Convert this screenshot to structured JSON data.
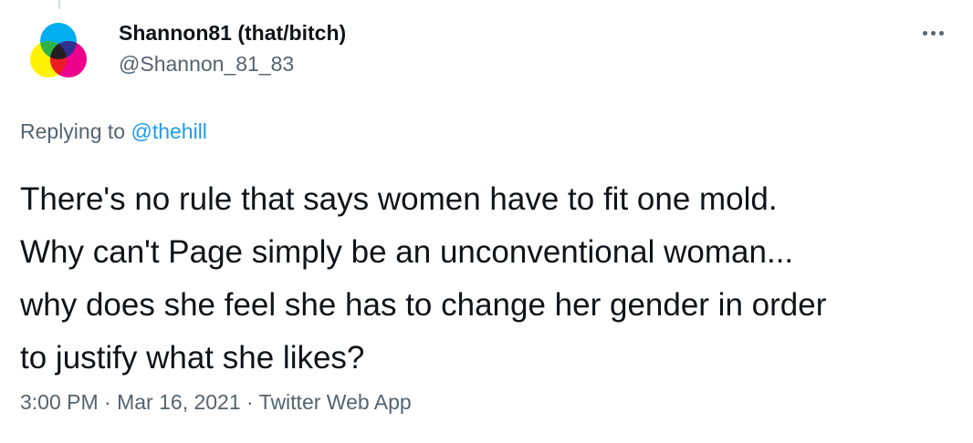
{
  "author": {
    "display_name": "Shannon81 (that/bitch)",
    "handle": "@Shannon_81_83",
    "avatar_icon": "cmyk-overlapping-circles-avatar"
  },
  "more_icon": "more-dots-icon",
  "reply_context": {
    "prefix": "Replying to ",
    "mention": "@thehill"
  },
  "tweet": {
    "text": "There's no rule that says women have to fit one mold.\nWhy can't Page simply be an unconventional woman...\nwhy does she feel she has to change her gender in order\nto justify what she likes?"
  },
  "meta": {
    "time": "3:00 PM",
    "sep1": " · ",
    "date": "Mar 16, 2021",
    "sep2": " · ",
    "source": "Twitter Web App"
  },
  "colors": {
    "text": "#0f1419",
    "secondary": "#536471",
    "link": "#1d9bf0",
    "avatar_cyan": "#00aeef",
    "avatar_magenta": "#ec008c",
    "avatar_yellow": "#fff200"
  }
}
